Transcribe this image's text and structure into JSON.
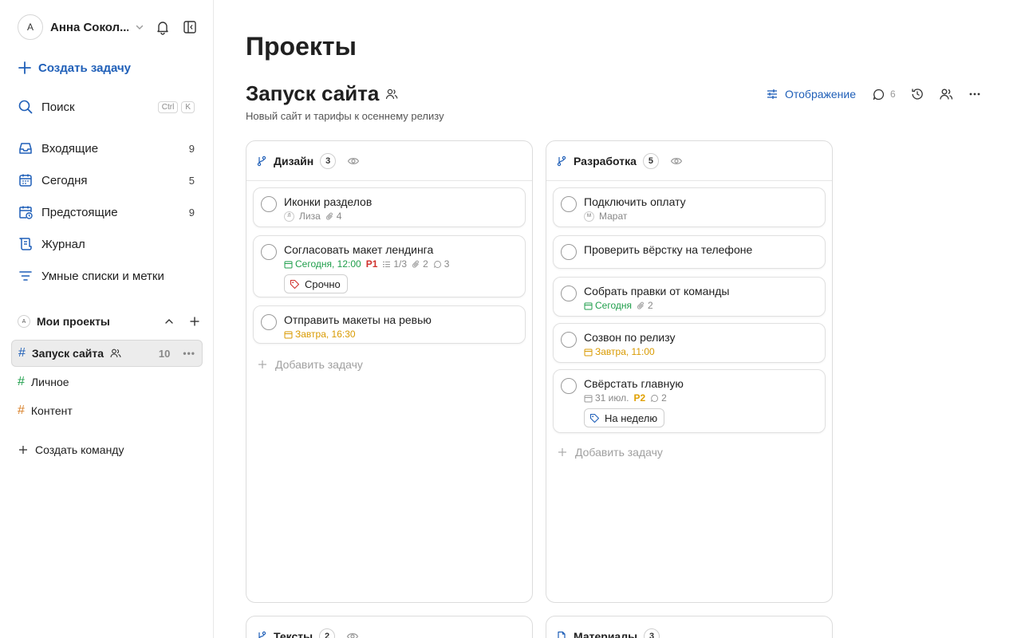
{
  "user": {
    "initial": "A",
    "name": "Анна Сокол..."
  },
  "sidebar": {
    "create_task": "Создать задачу",
    "search": {
      "label": "Поиск",
      "shortcut": [
        "Ctrl",
        "K"
      ]
    },
    "nav": [
      {
        "label": "Входящие",
        "count": "9",
        "icon": "inbox-icon"
      },
      {
        "label": "Сегодня",
        "count": "5",
        "icon": "calendar-today-icon"
      },
      {
        "label": "Предстоящие",
        "count": "9",
        "icon": "calendar-upcoming-icon"
      },
      {
        "label": "Журнал",
        "count": "",
        "icon": "journal-icon"
      },
      {
        "label": "Умные списки и метки",
        "count": "",
        "icon": "filter-icon"
      }
    ],
    "projects_head": {
      "initial": "A",
      "label": "Мои проекты"
    },
    "projects": [
      {
        "label": "Запуск сайта",
        "count": "10",
        "hash_color": "#1f5fb8"
      },
      {
        "label": "Личное",
        "count": "",
        "hash_color": "#1f9e4b"
      },
      {
        "label": "Контент",
        "count": "",
        "hash_color": "#d9822b"
      }
    ],
    "create_team": "Создать команду"
  },
  "main": {
    "page_title": "Проекты",
    "project_title": "Запуск сайта",
    "project_desc": "Новый сайт и тарифы к осеннему релизу",
    "toolbar": {
      "view": "Отображение",
      "comments": "6"
    }
  },
  "columns": [
    {
      "name": "Дизайн",
      "count": "3",
      "add_label": "Добавить задачу",
      "tasks": [
        {
          "title": "Иконки разделов",
          "assignee_initial": "Л",
          "assignee": "Лиза",
          "attachments": "4"
        },
        {
          "title": "Согласовать макет лендинга",
          "date": "Сегодня, 12:00",
          "priority": "P1",
          "subtasks": "1/3",
          "attachments": "2",
          "comments": "3",
          "tag": "Срочно"
        },
        {
          "title": "Отправить макеты на ревью",
          "date": "Завтра, 16:30"
        }
      ]
    },
    {
      "name": "Разработка",
      "count": "5",
      "add_label": "Добавить задачу",
      "tasks": [
        {
          "title": "Подключить оплату",
          "assignee_initial": "М",
          "assignee": "Марат"
        },
        {
          "title": "Проверить вёрстку на телефоне"
        },
        {
          "title": "Собрать правки от команды",
          "date": "Сегодня",
          "attachments": "2"
        },
        {
          "title": "Созвон по релизу",
          "date": "Завтра, 11:00"
        },
        {
          "title": "Свёрстать главную",
          "date": "31 июл.",
          "priority": "P2",
          "comments": "2",
          "tag": "На неделю"
        }
      ]
    },
    {
      "name": "Тексты",
      "count": "2"
    },
    {
      "name": "Материалы",
      "count": "3"
    }
  ]
}
